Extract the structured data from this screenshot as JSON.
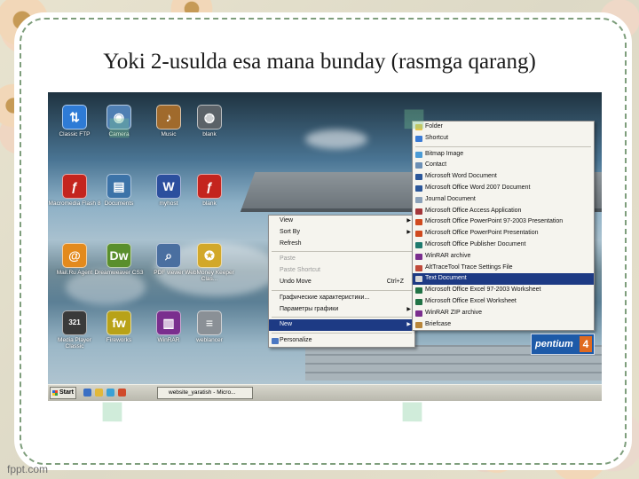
{
  "slide": {
    "title": "Yoki 2-usulda esa mana bunday (rasmga qarang)",
    "credit": "fppt.com"
  },
  "desktop": {
    "icons": [
      {
        "label": "Classic FTP",
        "icon": "ftp-icon",
        "color": "#2e7bd6",
        "glyph": "⇅"
      },
      {
        "label": "Camera",
        "icon": "camera-icon",
        "color": "#4f7fb3",
        "glyph": "◉"
      },
      {
        "label": "Music",
        "icon": "music-icon",
        "color": "#a06a2c",
        "glyph": "♪"
      },
      {
        "label": "blank",
        "icon": "blank-file-icon",
        "color": "#5b6268",
        "glyph": "◍"
      },
      {
        "label": "Macromedia Flash 8",
        "icon": "flash-icon",
        "color": "#c4241e",
        "glyph": "ƒ"
      },
      {
        "label": "Documents",
        "icon": "documents-icon",
        "color": "#3c73a8",
        "glyph": "▤"
      },
      {
        "label": "myhost",
        "icon": "word-doc-icon",
        "color": "#2c4f9e",
        "glyph": "W"
      },
      {
        "label": "blank",
        "icon": "flash-file-icon",
        "color": "#c4241e",
        "glyph": "ƒ"
      },
      {
        "label": "Mail.Ru Agent",
        "icon": "mail-agent-icon",
        "color": "#e38a1d",
        "glyph": "@"
      },
      {
        "label": "Dreamweaver CS3",
        "icon": "dreamweaver-icon",
        "color": "#5a8f2c",
        "glyph": "Dw"
      },
      {
        "label": "PDF viewer",
        "icon": "pdf-viewer-icon",
        "color": "#4a6fa0",
        "glyph": "⌕"
      },
      {
        "label": "WebMoney Keeper Clas...",
        "icon": "webmoney-icon",
        "color": "#d2a82a",
        "glyph": "✪"
      },
      {
        "label": "Media Player Classic",
        "icon": "media-player-icon",
        "color": "#3a3a3a",
        "glyph": "321"
      },
      {
        "label": "Fireworks",
        "icon": "fireworks-icon",
        "color": "#b8a218",
        "glyph": "fw"
      },
      {
        "label": "WinRAR",
        "icon": "winrar-icon",
        "color": "#7a2e8e",
        "glyph": "▥"
      },
      {
        "label": "weblancer",
        "icon": "text-file-icon",
        "color": "#8a9096",
        "glyph": "≡"
      }
    ]
  },
  "context_menu": {
    "items": [
      {
        "label": "View",
        "submenu": true
      },
      {
        "label": "Sort By",
        "submenu": true
      },
      {
        "label": "Refresh"
      },
      {
        "separator": true
      },
      {
        "label": "Paste",
        "disabled": true
      },
      {
        "label": "Paste Shortcut",
        "disabled": true
      },
      {
        "label": "Undo Move",
        "shortcut": "Ctrl+Z"
      },
      {
        "separator": true
      },
      {
        "label": "Графические характеристики..."
      },
      {
        "label": "Параметры графики",
        "submenu": true
      },
      {
        "separator": true
      },
      {
        "label": "New",
        "submenu": true,
        "highlight": true
      },
      {
        "separator": true
      },
      {
        "label": "Personalize",
        "icon": "personalize-icon"
      }
    ]
  },
  "new_submenu": {
    "items": [
      {
        "label": "Folder",
        "icon": "folder-icon",
        "color": "#e7c64a"
      },
      {
        "label": "Shortcut",
        "icon": "shortcut-icon",
        "color": "#3a7bd5"
      },
      {
        "separator": true
      },
      {
        "label": "Bitmap Image",
        "icon": "bitmap-icon",
        "color": "#4a9bd6"
      },
      {
        "label": "Contact",
        "icon": "contact-icon",
        "color": "#6b8fb5"
      },
      {
        "label": "Microsoft Word Document",
        "icon": "word-icon",
        "color": "#2b579a"
      },
      {
        "label": "Microsoft Office Word 2007 Document",
        "icon": "word-icon",
        "color": "#2b579a"
      },
      {
        "label": "Journal Document",
        "icon": "journal-icon",
        "color": "#8aa0b8"
      },
      {
        "label": "Microsoft Office Access Application",
        "icon": "access-icon",
        "color": "#a4373a"
      },
      {
        "label": "Microsoft Office PowerPoint 97-2003 Presentation",
        "icon": "powerpoint-icon",
        "color": "#d04a1f"
      },
      {
        "label": "Microsoft Office PowerPoint Presentation",
        "icon": "powerpoint-icon",
        "color": "#d04a1f"
      },
      {
        "label": "Microsoft Office Publisher Document",
        "icon": "publisher-icon",
        "color": "#1f7a6e"
      },
      {
        "label": "WinRAR archive",
        "icon": "winrar-icon",
        "color": "#7a2e8e"
      },
      {
        "label": "AltTraceTool Trace Settings File",
        "icon": "settings-file-icon",
        "color": "#c04a3a"
      },
      {
        "label": "Text Document",
        "icon": "text-document-icon",
        "color": "#d8d8d8",
        "highlight": true
      },
      {
        "label": "Microsoft Office Excel 97-2003 Worksheet",
        "icon": "excel-icon",
        "color": "#217346"
      },
      {
        "label": "Microsoft Office Excel Worksheet",
        "icon": "excel-icon",
        "color": "#217346"
      },
      {
        "label": "WinRAR ZIP archive",
        "icon": "zip-icon",
        "color": "#7a2e8e"
      },
      {
        "label": "Briefcase",
        "icon": "briefcase-icon",
        "color": "#b8863a"
      }
    ]
  },
  "taskbar": {
    "start_label": "Start",
    "task_label": "website_yaratish - Micro..."
  },
  "badge": {
    "text": "pentium",
    "number": "4"
  }
}
